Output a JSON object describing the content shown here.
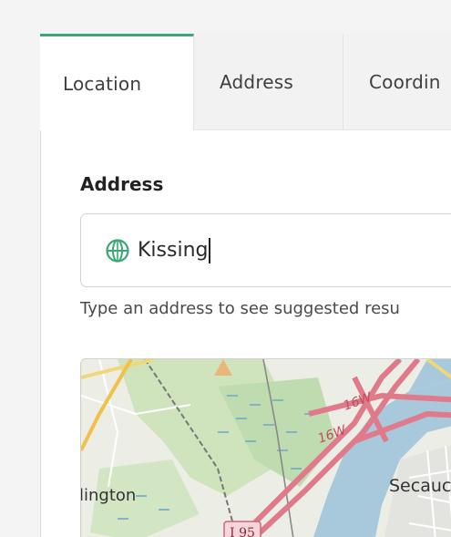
{
  "tabs": [
    {
      "label": "Location",
      "active": true
    },
    {
      "label": "Address",
      "active": false
    },
    {
      "label": "Coordin",
      "active": false
    }
  ],
  "field": {
    "label": "Address",
    "value": "Kissing",
    "icon": "globe-icon"
  },
  "helper": "Type an address to see suggested resu",
  "map": {
    "labels": {
      "town_left": "lington",
      "town_right": "Secauc",
      "highway": "I 95",
      "route_a": "16W",
      "route_b": "16W"
    }
  },
  "colors": {
    "accent": "#3aa876",
    "water": "#a8c8dc",
    "highway": "#e07a8a",
    "park": "#c9dfb4"
  }
}
